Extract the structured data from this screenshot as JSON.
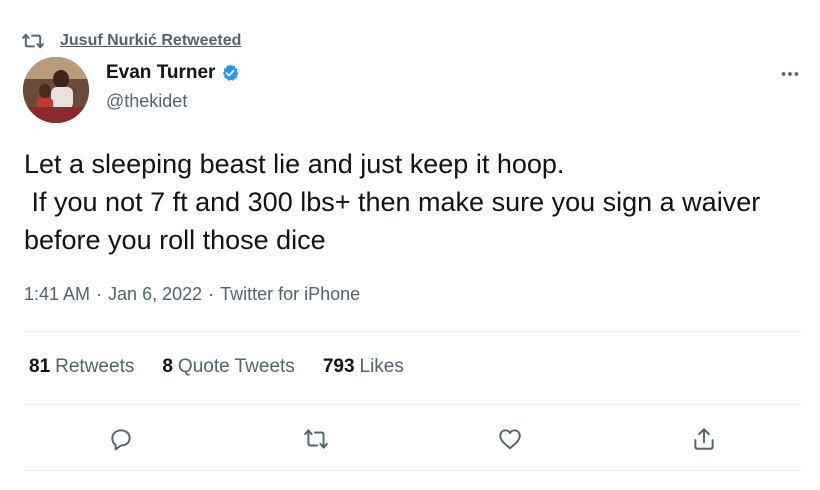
{
  "retweet_context": {
    "label": "Jusuf Nurkić Retweeted"
  },
  "author": {
    "name": "Evan Turner",
    "handle": "@thekidet"
  },
  "tweet": {
    "text": "Let a sleeping beast lie and just keep it hoop.\n If you not 7 ft and 300 lbs+ then make sure you sign a waiver before you roll those dice",
    "time": "1:41 AM",
    "date": "Jan 6, 2022",
    "source": "Twitter for iPhone",
    "separator": "·"
  },
  "stats": {
    "retweets": {
      "count": "81",
      "label": "Retweets"
    },
    "quote_tweets": {
      "count": "8",
      "label": "Quote Tweets"
    },
    "likes": {
      "count": "793",
      "label": "Likes"
    }
  },
  "icons": {
    "retweet": "retweet-icon",
    "verified": "verified-badge-icon",
    "more": "more-options-icon",
    "reply": "reply-icon",
    "like": "heart-icon",
    "share": "share-icon"
  },
  "colors": {
    "verified": "#1d9bf0",
    "secondary_text": "#536471",
    "primary_text": "#0f1419",
    "divider": "#eff3f4"
  }
}
